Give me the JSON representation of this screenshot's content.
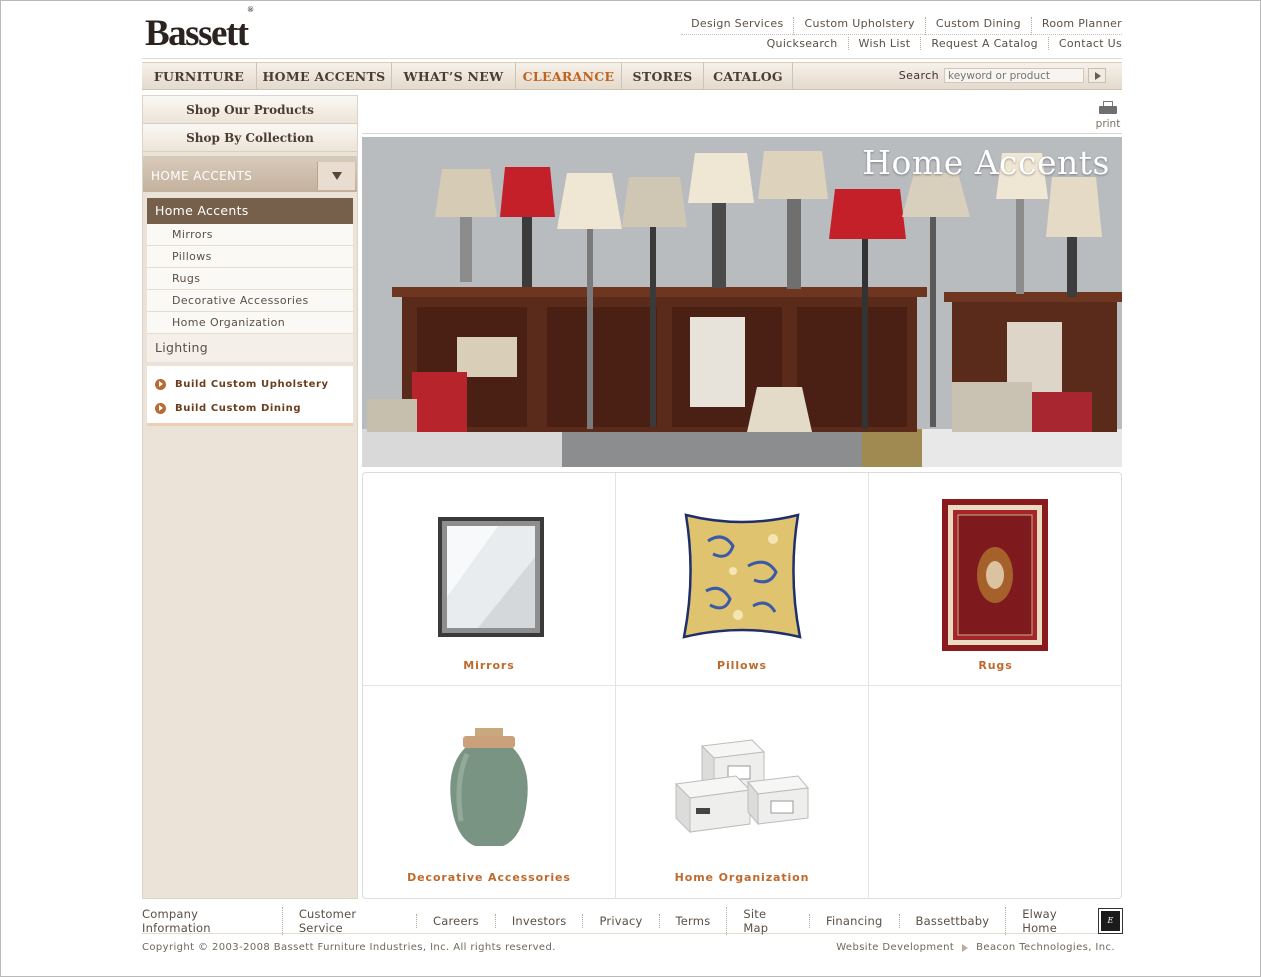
{
  "brand": {
    "logo": "Bassett",
    "registered": "®"
  },
  "utility_nav": {
    "row1": [
      "Design Services",
      "Custom Upholstery",
      "Custom Dining",
      "Room Planner"
    ],
    "row2": [
      "Quicksearch",
      "Wish List",
      "Request A Catalog",
      "Contact Us"
    ]
  },
  "main_nav": {
    "tabs": [
      {
        "label": "FURNITURE",
        "active": false
      },
      {
        "label": "HOME ACCENTS",
        "active": false
      },
      {
        "label": "WHAT’S NEW",
        "active": false
      },
      {
        "label": "CLEARANCE",
        "active": true
      },
      {
        "label": "STORES",
        "active": false
      },
      {
        "label": "CATALOG",
        "active": false
      }
    ],
    "search": {
      "label": "Search",
      "placeholder": "keyword or product"
    }
  },
  "sidebar": {
    "shop_buttons": [
      "Shop Our Products",
      "Shop By Collection"
    ],
    "category_dropdown": "HOME ACCENTS",
    "current_section": "Home Accents",
    "sub_items": [
      "Mirrors",
      "Pillows",
      "Rugs",
      "Decorative Accessories",
      "Home Organization"
    ],
    "other_section": "Lighting",
    "build_links": [
      "Build Custom Upholstery",
      "Build Custom Dining"
    ]
  },
  "content": {
    "print_label": "print",
    "banner_title": "Home Accents",
    "products": [
      {
        "name": "Mirrors",
        "icon": "mirror-icon"
      },
      {
        "name": "Pillows",
        "icon": "pillow-icon"
      },
      {
        "name": "Rugs",
        "icon": "rug-icon"
      },
      {
        "name": "Decorative Accessories",
        "icon": "vase-icon"
      },
      {
        "name": "Home Organization",
        "icon": "storage-boxes-icon"
      }
    ]
  },
  "footer": {
    "links": [
      "Company Information",
      "Customer Service",
      "Careers",
      "Investors",
      "Privacy",
      "Terms",
      "Site Map",
      "Financing",
      "Bassettbaby",
      "Elway Home"
    ],
    "copyright": "Copyright © 2003-2008 Bassett Furniture Industries, Inc. All rights reserved.",
    "credit_label": "Website Development",
    "credit_company": "Beacon Technologies, Inc."
  },
  "colors": {
    "accent": "#c0631d",
    "sidebar_bg": "#ece3d8",
    "sidebar_active": "#76604c",
    "product_label": "#bf6a2a"
  }
}
